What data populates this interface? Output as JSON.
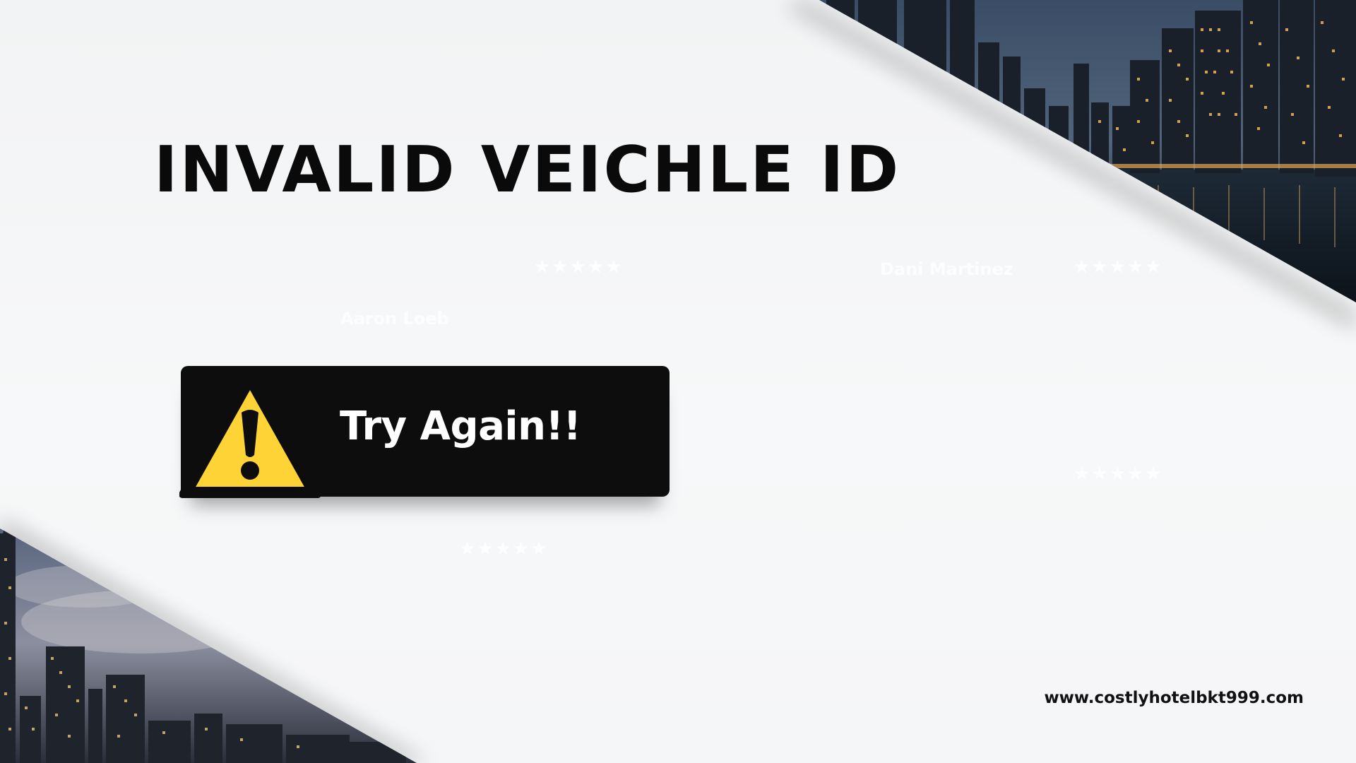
{
  "page": {
    "title": "INVALID VEICHLE ID",
    "button": {
      "label": "Try Again!!",
      "icon": "warning-triangle-icon"
    },
    "footer_url": "www.costlyhotelbkt999.com"
  },
  "background": {
    "names": [
      "Aaron Loeb",
      "Dani Martinez"
    ],
    "stars": "★★★★★",
    "colors": {
      "page": "#f5f6f7",
      "button": "#0d0d0d",
      "warning": "#fdd335"
    }
  }
}
